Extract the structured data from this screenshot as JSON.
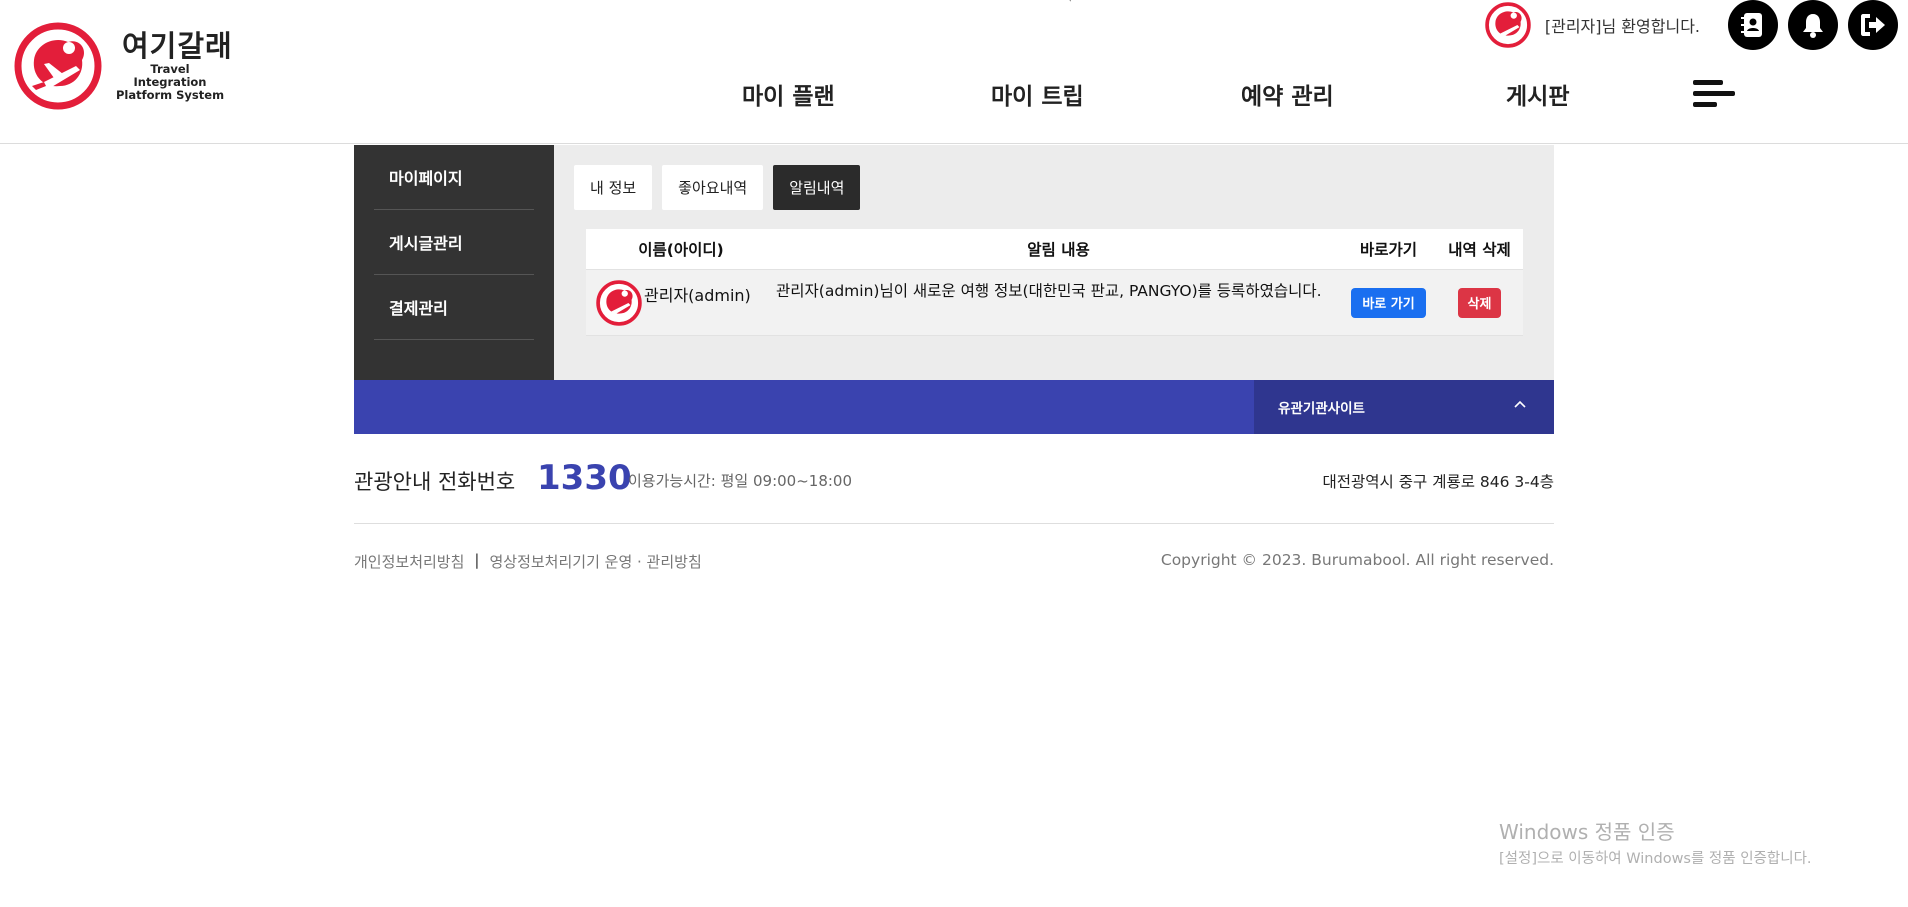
{
  "brand": {
    "name": "여기갈래",
    "subtitle_line1": "Travel Integration",
    "subtitle_line2": "Platform System",
    "colors": {
      "logo_red": "#e31e3a",
      "accent_blue": "#3a43af",
      "dark": "#333333"
    }
  },
  "topbar": {
    "welcome": "[관리자]님 환영합니다.",
    "icons": [
      "contact-book-icon",
      "bell-icon",
      "logout-icon"
    ]
  },
  "nav": {
    "items": [
      "마이 플랜",
      "마이 트립",
      "예약 관리",
      "게시판"
    ],
    "menu_icon": "hamburger-menu-icon"
  },
  "sidebar": {
    "items": [
      "마이페이지",
      "게시글관리",
      "결제관리"
    ]
  },
  "tabs": {
    "items": [
      "내 정보",
      "좋아요내역",
      "알림내역"
    ],
    "active": "알림내역"
  },
  "table": {
    "headers": [
      "이름(아이디)",
      "알림 내용",
      "바로가기",
      "내역 삭제"
    ],
    "rows": [
      {
        "name": "관리자(admin)",
        "content": "관리자(admin)님이 새로운 여행 정보(대한민국 판교, PANGYO)를 등록하였습니다.",
        "go_label": "바로 가기",
        "delete_label": "삭제"
      }
    ]
  },
  "footer": {
    "related_sites": "유관기관사이트",
    "phone_label": "관광안내 전화번호",
    "phone_number": "1330",
    "hours": "이용가능시간: 평일 09:00~18:00",
    "address": "대전광역시 중구 계룡로 846 3-4층",
    "links": [
      "개인정보처리방침",
      "영상정보처리기기 운영 · 관리방침"
    ],
    "link_separator": "|",
    "copyright": "Copyright © 2023. Burumabool. All right reserved."
  },
  "watermark": {
    "line1": "Windows 정품 인증",
    "line2": "[설정]으로 이동하여 Windows를 정품 인증합니다."
  }
}
